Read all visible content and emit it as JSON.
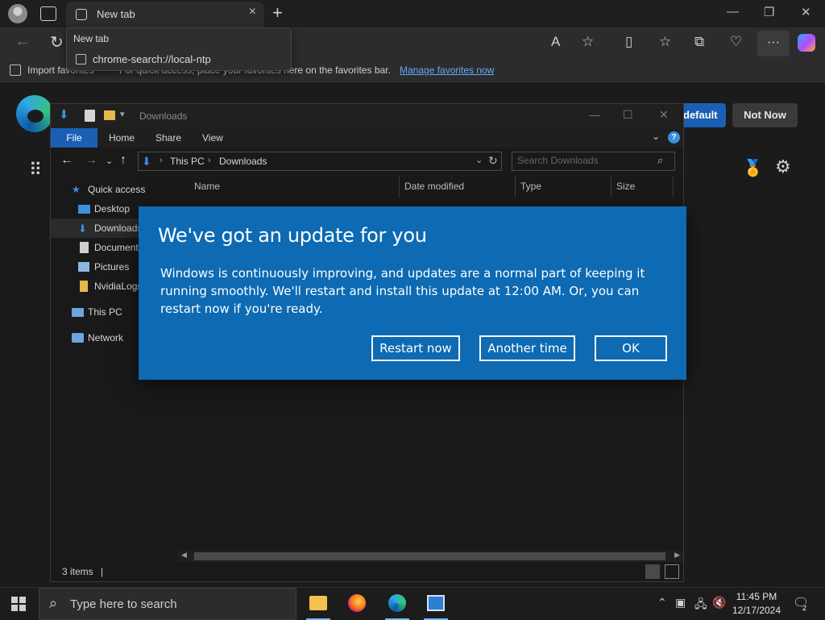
{
  "browser": {
    "tab_title": "New tab",
    "tooltip": {
      "title": "New tab",
      "url": "chrome-search://local-ntp"
    },
    "favorites_bar": {
      "import_label": "Import favorites",
      "hint": "For quick access, place your favorites here on the favorites bar.",
      "link": "Manage favorites now"
    },
    "default_banner": {
      "set_default_label": "default",
      "not_now_label": "Not Now"
    }
  },
  "explorer": {
    "title": "Downloads",
    "ribbon": [
      "File",
      "Home",
      "Share",
      "View"
    ],
    "address": [
      "This PC",
      "Downloads"
    ],
    "search_placeholder": "Search Downloads",
    "nav": [
      {
        "label": "Quick access",
        "icon": "star-icon"
      },
      {
        "label": "Desktop",
        "icon": "desktop-icon"
      },
      {
        "label": "Downloads",
        "icon": "download-icon"
      },
      {
        "label": "Documents",
        "icon": "document-icon"
      },
      {
        "label": "Pictures",
        "icon": "picture-icon"
      },
      {
        "label": "NvidiaLogs",
        "icon": "folder-icon"
      },
      {
        "label": "This PC",
        "icon": "computer-icon"
      },
      {
        "label": "Network",
        "icon": "network-icon"
      }
    ],
    "columns": [
      "Name",
      "Date modified",
      "Type",
      "Size"
    ],
    "status": "3 items"
  },
  "dialog": {
    "title": "We've got an update for you",
    "body": "Windows is continuously improving, and updates are a normal part of keeping it running smoothly. We'll restart and install this update at 12:00 AM. Or, you can restart now if you're ready.",
    "buttons": {
      "restart": "Restart now",
      "later": "Another time",
      "ok": "OK"
    }
  },
  "taskbar": {
    "search_placeholder": "Type here to search",
    "apps": [
      "file-explorer",
      "firefox",
      "edge",
      "app"
    ],
    "time": "11:45 PM",
    "date": "12/17/2024",
    "notifications": "2"
  },
  "colors": {
    "dialog_bg": "#0d6ab3",
    "accent": "#1a5fb4"
  }
}
